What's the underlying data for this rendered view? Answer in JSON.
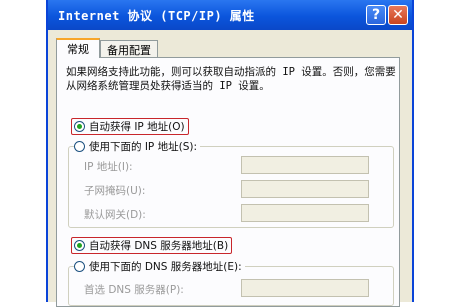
{
  "window": {
    "title": "Internet 协议 (TCP/IP) 属性",
    "help_label": "?",
    "close_label": "✕"
  },
  "tabs": [
    {
      "label": "常规",
      "active": true
    },
    {
      "label": "备用配置",
      "active": false
    }
  ],
  "description": "如果网络支持此功能，则可以获取自动指派的 IP 设置。否则，您需要从网络系统管理员处获得适当的 IP 设置。",
  "ip_section": {
    "auto_label": "自动获得 IP 地址(O)",
    "auto_selected": true,
    "manual_label": "使用下面的 IP 地址(S):",
    "fields": [
      {
        "label": "IP 地址(I):",
        "value": ""
      },
      {
        "label": "子网掩码(U):",
        "value": ""
      },
      {
        "label": "默认网关(D):",
        "value": ""
      }
    ]
  },
  "dns_section": {
    "auto_label": "自动获得 DNS 服务器地址(B)",
    "auto_selected": true,
    "manual_label": "使用下面的 DNS 服务器地址(E):",
    "fields": [
      {
        "label": "首选 DNS 服务器(P):",
        "value": ""
      }
    ]
  },
  "colors": {
    "titlebar": "#0b55dc",
    "highlight_box": "#c8262b",
    "dialog_bg": "#ece9d8"
  }
}
